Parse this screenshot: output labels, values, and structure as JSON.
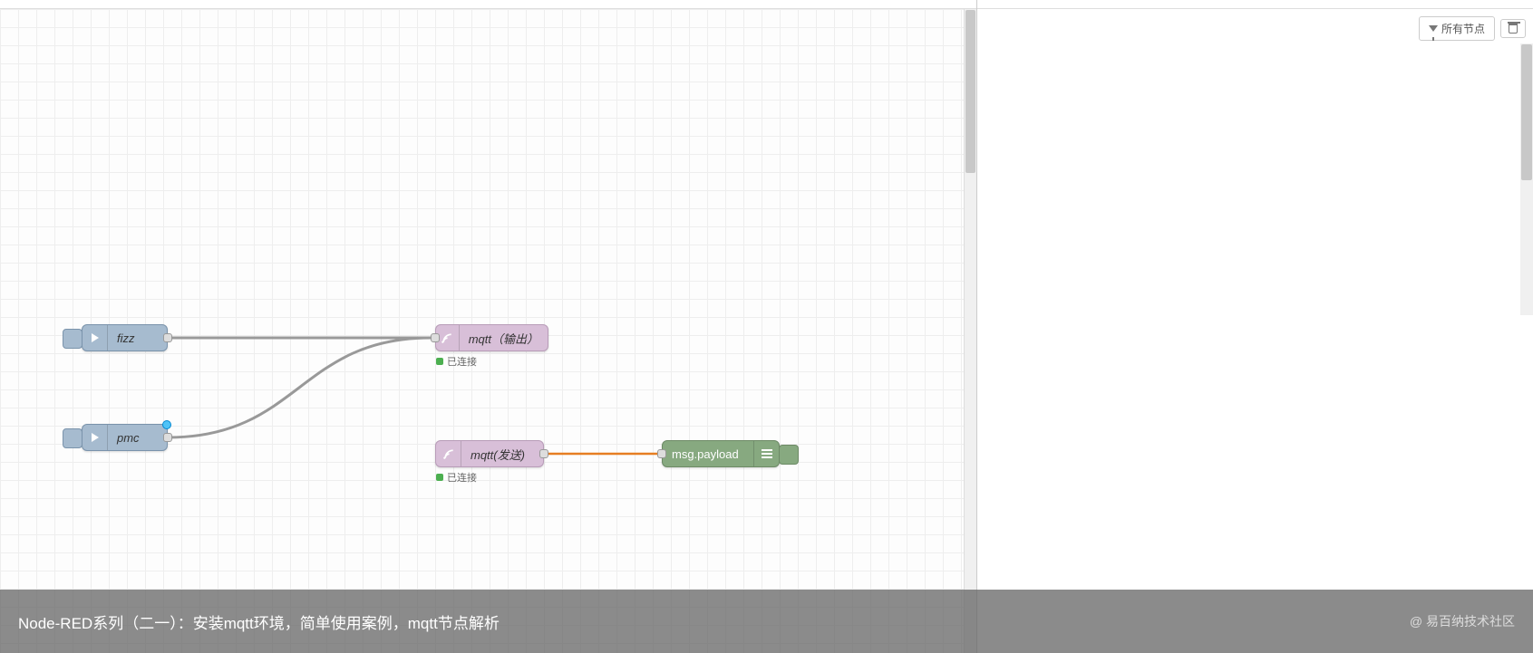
{
  "sidebar": {
    "filter_label": "所有节点",
    "trash_tooltip": "删除"
  },
  "nodes": {
    "fizz": {
      "label": "fizz"
    },
    "pmc": {
      "label": "pmc"
    },
    "mqtt_out": {
      "label": "mqtt（输出）",
      "status": "已连接"
    },
    "mqtt_send": {
      "label": "mqtt(发送)",
      "status": "已连接"
    },
    "debug": {
      "label": "msg.payload"
    }
  },
  "caption": {
    "text": "Node-RED系列（二一）：安装mqtt环境，简单使用案例，mqtt节点解析",
    "watermark": "@ 易百纳技术社区"
  }
}
